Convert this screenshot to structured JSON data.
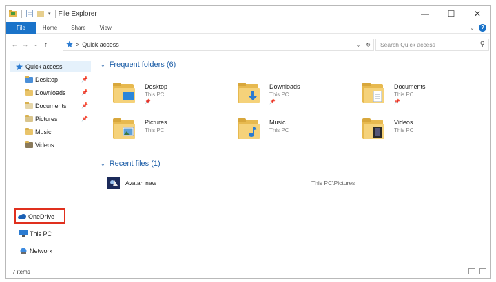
{
  "window": {
    "title": "File Explorer",
    "controls": {
      "minimize": "—",
      "maximize": "☐",
      "close": "✕"
    }
  },
  "ribbon": {
    "tabs": [
      {
        "label": "File"
      },
      {
        "label": "Home"
      },
      {
        "label": "Share"
      },
      {
        "label": "View"
      }
    ],
    "help": "?"
  },
  "address": {
    "path": "Quick access",
    "separator": ">",
    "search_placeholder": "Search Quick access"
  },
  "nav": {
    "quick_access": "Quick access",
    "items": [
      {
        "label": "Desktop",
        "pinned": true
      },
      {
        "label": "Downloads",
        "pinned": true
      },
      {
        "label": "Documents",
        "pinned": true
      },
      {
        "label": "Pictures",
        "pinned": true
      },
      {
        "label": "Music",
        "pinned": false
      },
      {
        "label": "Videos",
        "pinned": false
      }
    ],
    "onedrive": "OneDrive",
    "this_pc": "This PC",
    "network": "Network"
  },
  "frequent": {
    "header": "Frequent folders (6)",
    "folders": [
      {
        "name": "Desktop",
        "location": "This PC",
        "pinned": true,
        "icon": "desktop-badge"
      },
      {
        "name": "Downloads",
        "location": "This PC",
        "pinned": true,
        "icon": "download-arrow"
      },
      {
        "name": "Documents",
        "location": "This PC",
        "pinned": true,
        "icon": "document-badge"
      },
      {
        "name": "Pictures",
        "location": "This PC",
        "pinned": false,
        "icon": "picture-badge"
      },
      {
        "name": "Music",
        "location": "This PC",
        "pinned": false,
        "icon": "music-note"
      },
      {
        "name": "Videos",
        "location": "This PC",
        "pinned": false,
        "icon": "film-badge"
      }
    ]
  },
  "recent": {
    "header": "Recent files (1)",
    "files": [
      {
        "name": "Avatar_new",
        "path": "This PC\\Pictures"
      }
    ]
  },
  "status": {
    "item_count": "7 items"
  },
  "colors": {
    "accent": "#1a73c9",
    "group_header": "#1e5fa8",
    "highlight_box": "#e0301e",
    "selected_bg": "#e5f1fb",
    "folder": "#e7b94f"
  }
}
